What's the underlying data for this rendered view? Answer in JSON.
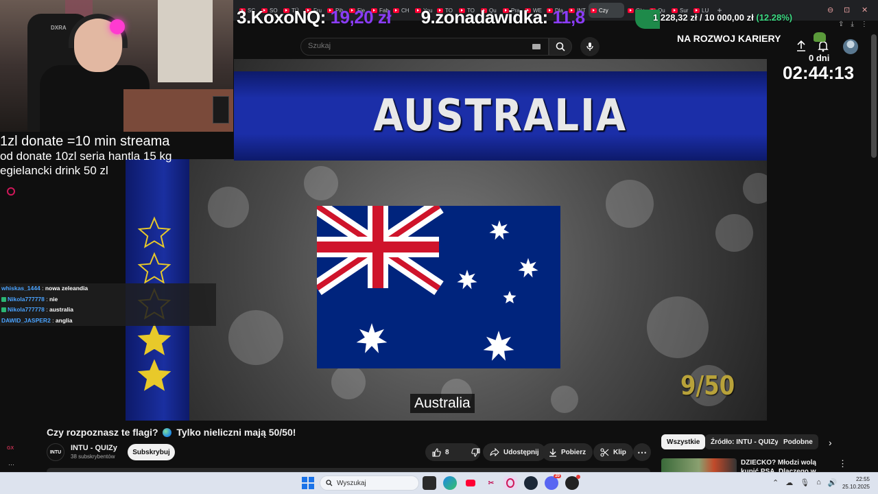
{
  "browser": {
    "tabs": [
      "SC",
      "SO",
      "TÜ",
      "Fru",
      "Pih",
      "Fie",
      "Fab",
      "CH",
      "You",
      "TO",
      "TO",
      "Qu",
      "Pra",
      "WE",
      "Dla",
      "INT",
      "Czy",
      "Giv",
      "Qu",
      "Sur",
      "LU"
    ],
    "active_tab_index": 16,
    "new_tab_label": "+",
    "window_controls": [
      "⊖",
      "⊡",
      "✕"
    ]
  },
  "youtube": {
    "search": {
      "placeholder": "Szukaj",
      "value": ""
    }
  },
  "overlay": {
    "leaderboard": [
      {
        "name": "3.KoxoNQ:",
        "amount": "19,20 zł"
      },
      {
        "name": "9.zonadawidka:",
        "amount": "11,8"
      }
    ],
    "goal": {
      "current": "1 228,32 zł",
      "target": "10 000,00 zł",
      "percent": "(12.28%)",
      "progress": 0.1228,
      "title": "NA ROZWOJ KARIERY"
    },
    "days": "0 dni",
    "timer": "02:44:13",
    "donate_info": [
      "1zl donate =10 min streama",
      "od donate 10zl seria hantla 15 kg",
      "egielancki drink 50 zl"
    ],
    "webcam_brand": "DXRA"
  },
  "video": {
    "country_title": "AUSTRALIA",
    "counter": "9/50",
    "caption": "Australia",
    "stars": {
      "empty": 3,
      "filled": 2,
      "total": 5
    },
    "colors": {
      "band": "#1b2ea8",
      "counter": "#b8a23a"
    }
  },
  "chat": [
    {
      "user": "whiskas_1444",
      "message": "nowa zeleandia",
      "badge": false
    },
    {
      "user": "Nikola777778",
      "message": "nie",
      "badge": true
    },
    {
      "user": "Nikola777778",
      "message": "australia",
      "badge": true
    },
    {
      "user": "DAWID_JASPER2",
      "message": "anglia",
      "badge": false
    }
  ],
  "watch": {
    "title_part1": "Czy rozpoznasz te flagi?",
    "title_part2": "Tylko nieliczni mają 50/50!",
    "channel_avatar_text": "INTU",
    "channel_name": "INTU - QUIZy",
    "subscribers": "38 subskrybentów",
    "subscribe_label": "Subskrybuj",
    "likes": "8",
    "share_label": "Udostępnij",
    "download_label": "Pobierz",
    "clip_label": "Klip",
    "more_label": "⋯"
  },
  "recommendations": {
    "chips": [
      "Wszystkie",
      "Źródło: INTU - QUIZy",
      "Podobne"
    ],
    "next_label": "›",
    "items": [
      {
        "title": "DZIECKO? Młodzi wolą kupić PSA. Dlaczego w Polsce rodzi"
      }
    ]
  },
  "sidebar_mini": [
    "GX",
    "⋯"
  ],
  "taskbar": {
    "search_placeholder": "Wyszukaj",
    "apps": [
      "file-explorer",
      "edge",
      "youtube",
      "snipping-tool",
      "opera",
      "steam",
      "discord",
      "obs"
    ],
    "discord_badge": "20",
    "time": "22:55",
    "date": "25.10.2025"
  }
}
